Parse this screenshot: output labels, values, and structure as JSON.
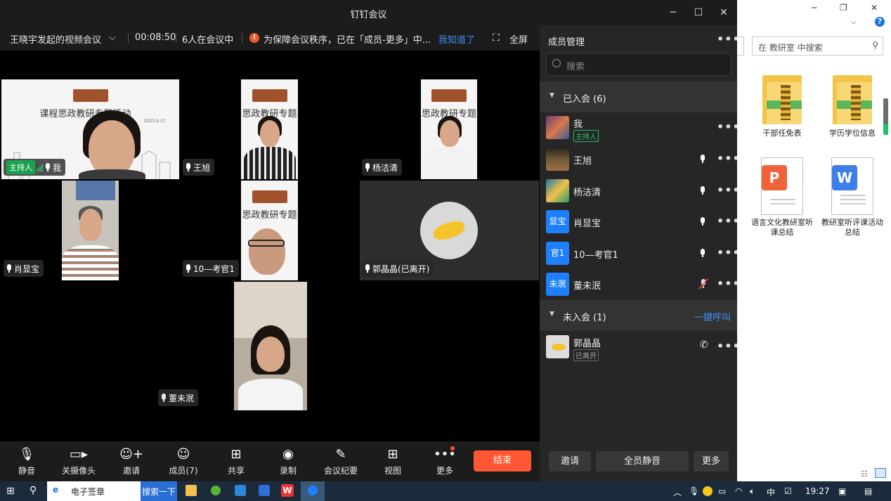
{
  "window": {
    "title": "钉钉会议",
    "minimize": "─",
    "maximize": "☐",
    "close": "✕"
  },
  "infobar": {
    "meeting_name": "王晓宇发起的视频会议",
    "dropdown": "⌵",
    "timer": "00:08:50",
    "count": "6人在会议中",
    "warn_glyph": "!",
    "notice": "为保障会议秩序，已在「成员-更多」中...",
    "ack_link": "我知道了",
    "fullscreen_glyph": "⛶",
    "fullscreen_label": "全屏"
  },
  "tiles": {
    "me": {
      "name": "我",
      "host_tag": "主持人",
      "slide_title": "课程思政教研专题活动",
      "slide_date": "2023.5.17"
    },
    "wang": {
      "name": "王旭",
      "slide_title": "思政教研专题"
    },
    "yang": {
      "name": "杨洁清",
      "slide_title": "思政教研专题"
    },
    "xiao": {
      "name": "肖显宝"
    },
    "kg": {
      "name": "10—考官1",
      "slide_title": "思政教研专题"
    },
    "guo": {
      "name": "郭晶晶(已离开)"
    },
    "dong": {
      "name": "董未泯"
    }
  },
  "toolbar": {
    "mute": "静音",
    "camera": "关摄像头",
    "invite": "邀请",
    "members": "成员(7)",
    "share": "共享",
    "record": "录制",
    "minutes": "会议纪要",
    "view": "视图",
    "more": "更多",
    "end": "结束"
  },
  "panel": {
    "title": "成员管理",
    "more": "•••",
    "search_placeholder": "搜索",
    "joined_label": "已入会 (6)",
    "not_joined_label": "未入会 (1)",
    "call_all": "一键呼叫",
    "members": [
      {
        "name": "我",
        "tag": "主持人"
      },
      {
        "name": "王旭"
      },
      {
        "name": "杨洁清"
      },
      {
        "name": "肖显宝",
        "avatar_text": "显宝"
      },
      {
        "name": "10—考官1",
        "avatar_text": "官1"
      },
      {
        "name": "董未泯",
        "avatar_text": "未泯"
      }
    ],
    "absent": [
      {
        "name": "郭晶晶",
        "tag": "已离开"
      }
    ],
    "invite_btn": "邀请",
    "mute_all_btn": "全员静音",
    "more_btn": "更多"
  },
  "explorer": {
    "search_placeholder": "在 教研室 中搜索",
    "items": [
      {
        "label": "干部任免表"
      },
      {
        "label": "学历学位信息"
      },
      {
        "label": "语言文化教研室听课总结"
      },
      {
        "label": "教研室听评课活动总结"
      }
    ],
    "ppt_glyph": "P",
    "word_glyph": "W"
  },
  "taskbar": {
    "search_label": "电子签章",
    "search_button": "搜索一下",
    "ime": "中",
    "time": "19:27"
  },
  "colors": {
    "accent_blue": "#1e80ff",
    "end_red": "#ff5733",
    "host_green": "#1aa251",
    "link": "#3e8ef7"
  }
}
